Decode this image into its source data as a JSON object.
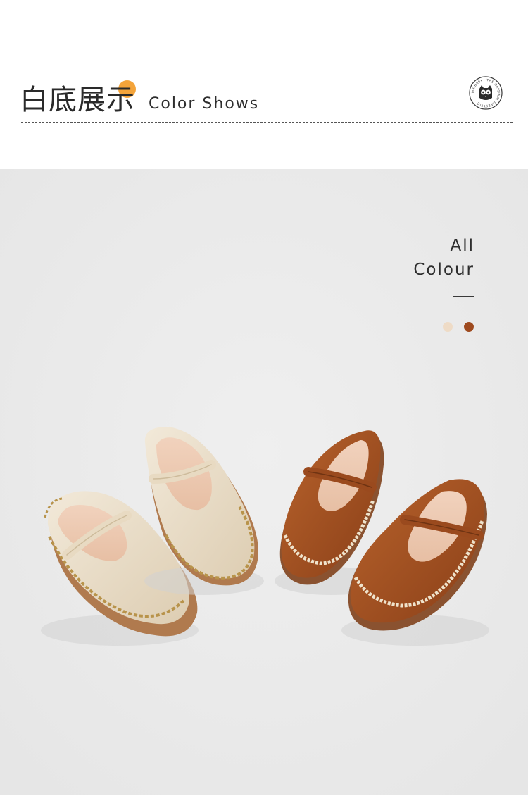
{
  "header": {
    "title_cn": "白底展示",
    "title_en": "Color Shows",
    "badge_text": "MR.BABY · THE ORIGINAL LIFESTYLE",
    "accent_color": "#f4a43a"
  },
  "colour_panel": {
    "line1": "All",
    "line2": "Colour",
    "swatches": [
      {
        "name": "beige",
        "color": "#eedbc6"
      },
      {
        "name": "brown",
        "color": "#9e4a1f"
      }
    ]
  },
  "product": {
    "photo_background": "#ebebeb",
    "variants": [
      {
        "name": "beige",
        "upper_color": "#ece0cc",
        "stitch_color": "#b8934a",
        "sole_color": "#b07a4e"
      },
      {
        "name": "brown",
        "upper_color": "#a4501f",
        "stitch_color": "#efe3cc",
        "sole_color": "#8a5230"
      }
    ]
  }
}
